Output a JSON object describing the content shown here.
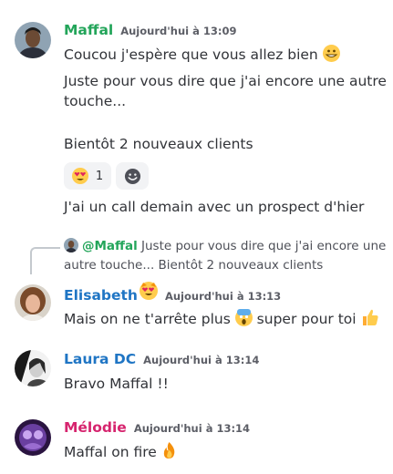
{
  "messages": {
    "m1": {
      "author": "Maffal",
      "author_color": "#23a55a",
      "timestamp": "Aujourd'hui à 13:09",
      "line1": "Coucou j'espère que vous allez bien",
      "line2a": "Juste pour vous dire que j'ai encore une autre",
      "line2b": "touche...",
      "line3": "Bientôt 2 nouveaux clients",
      "line4": "J'ai un call demain avec un prospect d'hier"
    },
    "reactions": {
      "r1_count": "1",
      "r1_emoji": "heart-eyes-emoji",
      "r2_emoji": "add-reaction-icon"
    },
    "reply": {
      "mention": "@Maffal",
      "text1": "Juste pour vous dire que j'ai encore une",
      "text2": "autre touche... Bientôt 2 nouveaux clients"
    },
    "m2": {
      "author": "Elisabeth",
      "author_color": "#1f75c4",
      "timestamp": "Aujourd'hui à 13:13",
      "text_a": "Mais on ne t'arrête plus",
      "text_b": "super pour toi"
    },
    "m3": {
      "author": "Laura DC",
      "author_color": "#1f75c4",
      "timestamp": "Aujourd'hui à 13:14",
      "text": "Bravo Maffal !!"
    },
    "m4": {
      "author": "Mélodie",
      "author_color": "#d6246e",
      "timestamp": "Aujourd'hui à 13:14",
      "text": "Maffal on fire"
    }
  }
}
